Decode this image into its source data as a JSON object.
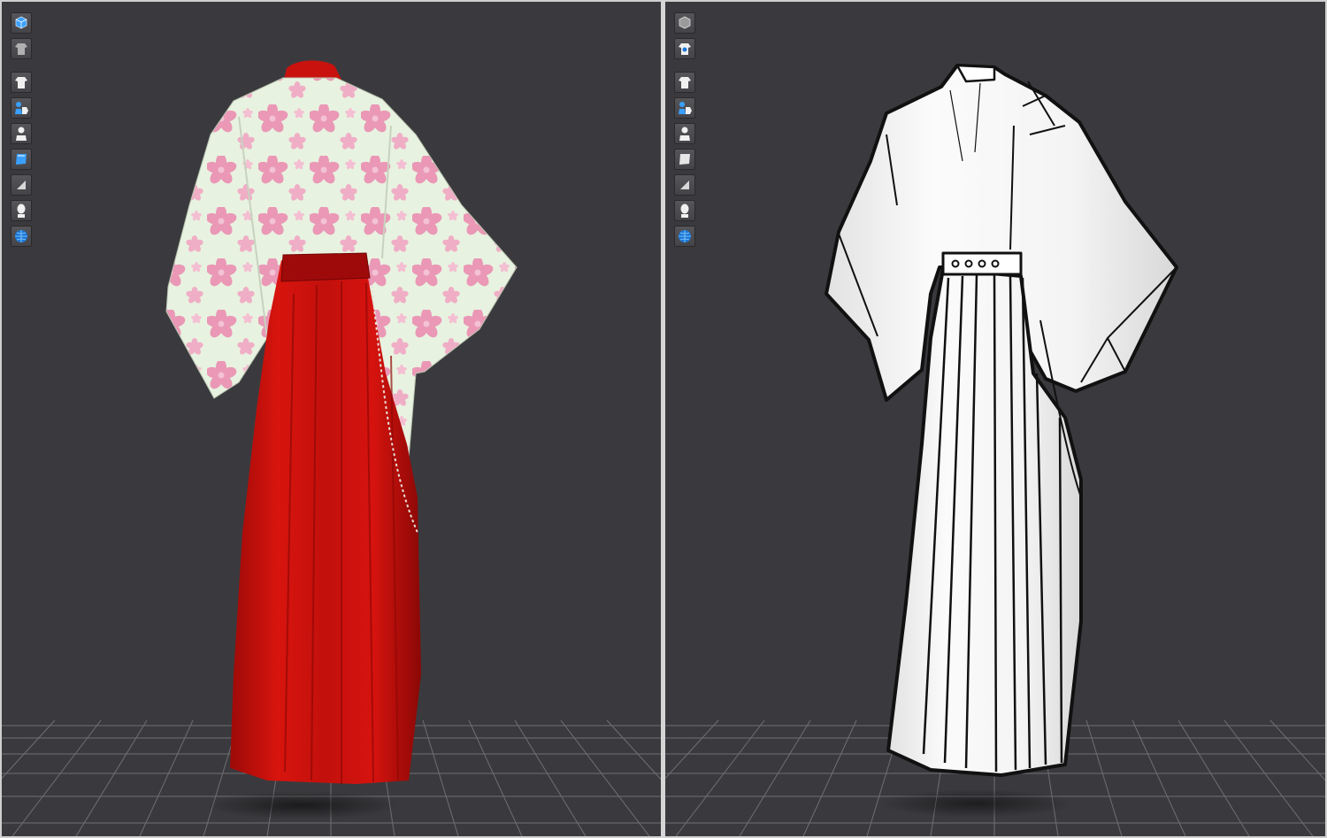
{
  "colors": {
    "viewport_bg": "#3a3a3e",
    "grid_line": "#6e6e74",
    "kimono_base": "#e8f2e0",
    "sakura_pink": "#ea98b6",
    "hakama_red": "#c8100c",
    "belt_red": "#9e0a0a",
    "lineart_white": "#f6f6f6",
    "outline_black": "#111111"
  },
  "viewports": [
    {
      "id": "left",
      "render_mode": "textured",
      "toolbar": [
        "render-mode-icon",
        "texture-mode-icon",
        "garment-icon",
        "avatar-garment-icon",
        "avatar-icon",
        "fabric-icon",
        "stretch-map-icon",
        "avatar-head-icon",
        "environment-icon"
      ]
    },
    {
      "id": "right",
      "render_mode": "line-art",
      "toolbar": [
        "render-mode-icon",
        "texture-mode-icon",
        "garment-icon",
        "avatar-garment-icon",
        "avatar-icon",
        "fabric-icon",
        "stretch-map-icon",
        "avatar-head-icon",
        "environment-icon"
      ]
    }
  ]
}
